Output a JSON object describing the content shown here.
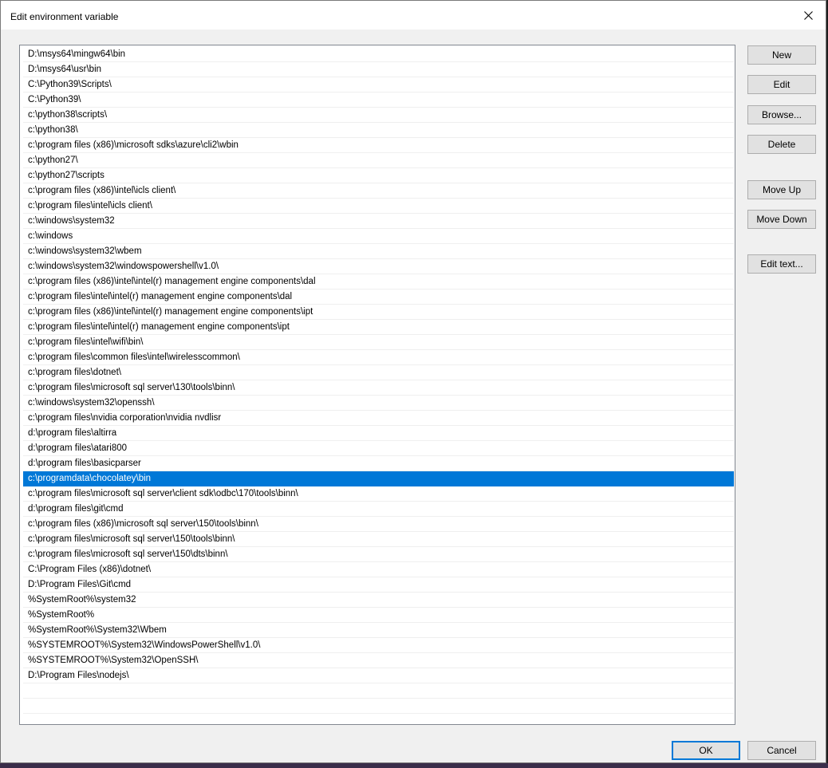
{
  "dialog": {
    "title": "Edit environment variable"
  },
  "paths": [
    "D:\\msys64\\mingw64\\bin",
    "D:\\msys64\\usr\\bin",
    "C:\\Python39\\Scripts\\",
    "C:\\Python39\\",
    "c:\\python38\\scripts\\",
    "c:\\python38\\",
    "c:\\program files (x86)\\microsoft sdks\\azure\\cli2\\wbin",
    "c:\\python27\\",
    "c:\\python27\\scripts",
    "c:\\program files (x86)\\intel\\icls client\\",
    "c:\\program files\\intel\\icls client\\",
    "c:\\windows\\system32",
    "c:\\windows",
    "c:\\windows\\system32\\wbem",
    "c:\\windows\\system32\\windowspowershell\\v1.0\\",
    "c:\\program files (x86)\\intel\\intel(r) management engine components\\dal",
    "c:\\program files\\intel\\intel(r) management engine components\\dal",
    "c:\\program files (x86)\\intel\\intel(r) management engine components\\ipt",
    "c:\\program files\\intel\\intel(r) management engine components\\ipt",
    "c:\\program files\\intel\\wifi\\bin\\",
    "c:\\program files\\common files\\intel\\wirelesscommon\\",
    "c:\\program files\\dotnet\\",
    "c:\\program files\\microsoft sql server\\130\\tools\\binn\\",
    "c:\\windows\\system32\\openssh\\",
    "c:\\program files\\nvidia corporation\\nvidia nvdlisr",
    "d:\\program files\\altirra",
    "d:\\program files\\atari800",
    "d:\\program files\\basicparser",
    "c:\\programdata\\chocolatey\\bin",
    "c:\\program files\\microsoft sql server\\client sdk\\odbc\\170\\tools\\binn\\",
    "d:\\program files\\git\\cmd",
    "c:\\program files (x86)\\microsoft sql server\\150\\tools\\binn\\",
    "c:\\program files\\microsoft sql server\\150\\tools\\binn\\",
    "c:\\program files\\microsoft sql server\\150\\dts\\binn\\",
    "C:\\Program Files (x86)\\dotnet\\",
    "D:\\Program Files\\Git\\cmd",
    "%SystemRoot%\\system32",
    "%SystemRoot%",
    "%SystemRoot%\\System32\\Wbem",
    "%SYSTEMROOT%\\System32\\WindowsPowerShell\\v1.0\\",
    "%SYSTEMROOT%\\System32\\OpenSSH\\",
    "D:\\Program Files\\nodejs\\"
  ],
  "selected_index": 28,
  "buttons": {
    "new": "New",
    "edit": "Edit",
    "browse": "Browse...",
    "delete": "Delete",
    "move_up": "Move Up",
    "move_down": "Move Down",
    "edit_text": "Edit text...",
    "ok": "OK",
    "cancel": "Cancel"
  },
  "colors": {
    "selection": "#0078d7",
    "dialog_bg": "#f0f0f0"
  }
}
